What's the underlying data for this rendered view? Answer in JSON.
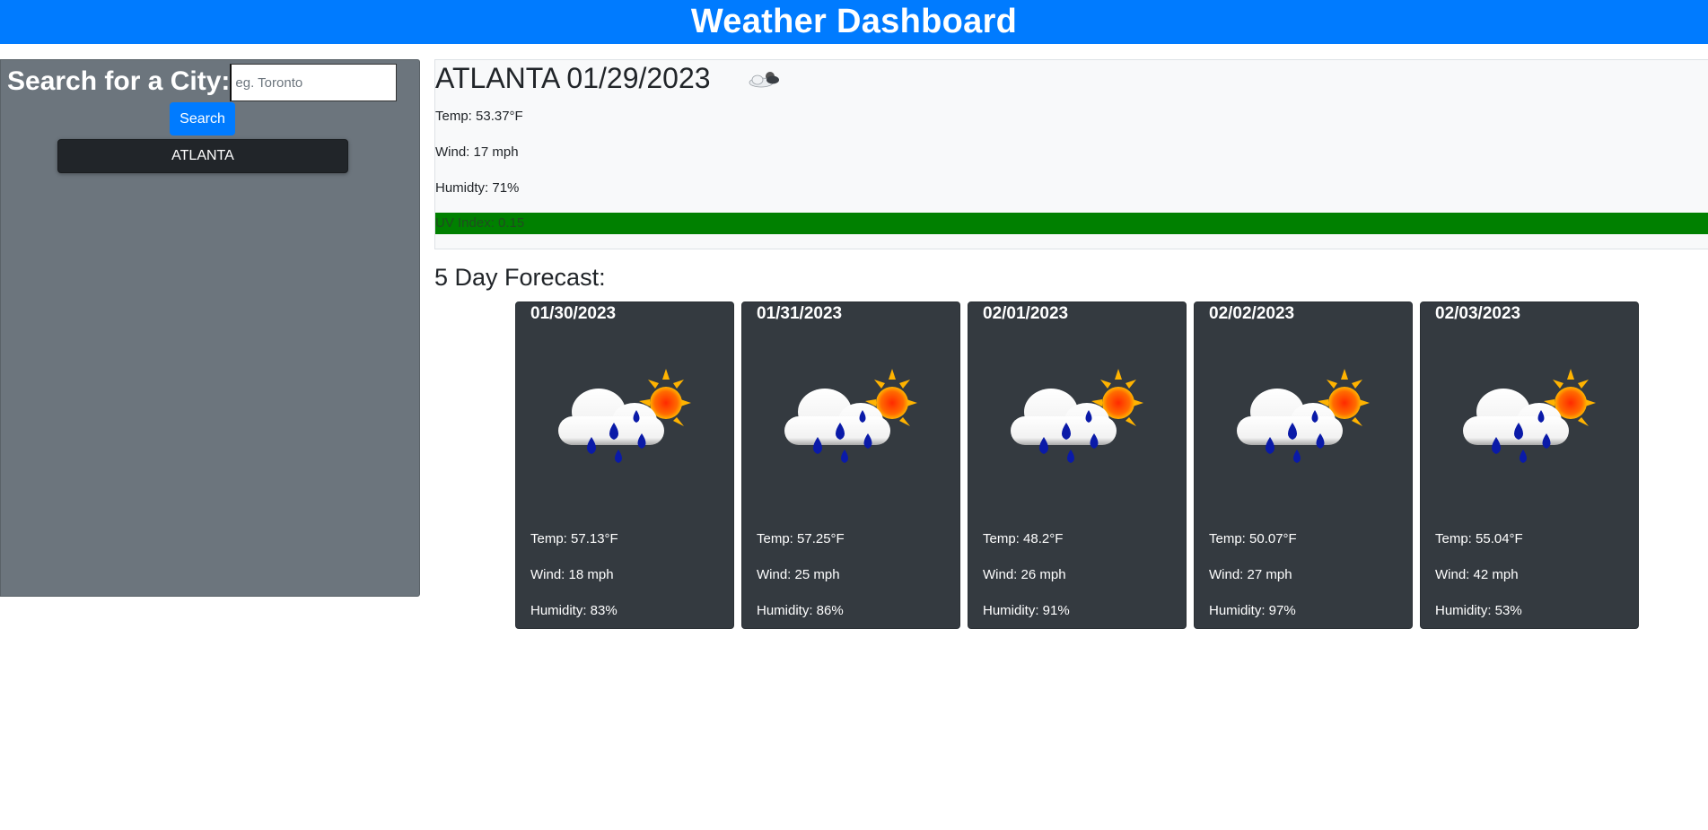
{
  "header": {
    "title": "Weather Dashboard"
  },
  "sidebar": {
    "search_label": "Search for a City:",
    "search_placeholder": "eg. Toronto",
    "search_value": "",
    "search_button": "Search",
    "history": [
      {
        "label": "ATLANTA"
      }
    ]
  },
  "current": {
    "title": "ATLANTA 01/29/2023",
    "icon": "partly-cloudy-icon",
    "temp": "Temp: 53.37°F",
    "wind": "Wind: 17 mph",
    "humidity": "Humidty: 71%",
    "uv": "UV Index: 0.15",
    "uv_color": "#008000"
  },
  "forecast": {
    "heading": "5 Day Forecast:",
    "days": [
      {
        "date": "01/30/2023",
        "icon": "rain-sun-icon",
        "temp": "Temp: 57.13°F",
        "wind": "Wind: 18 mph",
        "humidity": "Humidity: 83%"
      },
      {
        "date": "01/31/2023",
        "icon": "rain-sun-icon",
        "temp": "Temp: 57.25°F",
        "wind": "Wind: 25 mph",
        "humidity": "Humidity: 86%"
      },
      {
        "date": "02/01/2023",
        "icon": "rain-sun-icon",
        "temp": "Temp: 48.2°F",
        "wind": "Wind: 26 mph",
        "humidity": "Humidity: 91%"
      },
      {
        "date": "02/02/2023",
        "icon": "rain-sun-icon",
        "temp": "Temp: 50.07°F",
        "wind": "Wind: 27 mph",
        "humidity": "Humidity: 97%"
      },
      {
        "date": "02/03/2023",
        "icon": "rain-sun-icon",
        "temp": "Temp: 55.04°F",
        "wind": "Wind: 42 mph",
        "humidity": "Humidity: 53%"
      }
    ]
  },
  "colors": {
    "header_bg": "#007bff",
    "sidebar_bg": "#6c757d",
    "card_bg": "#343a40",
    "history_bg": "#212529"
  }
}
